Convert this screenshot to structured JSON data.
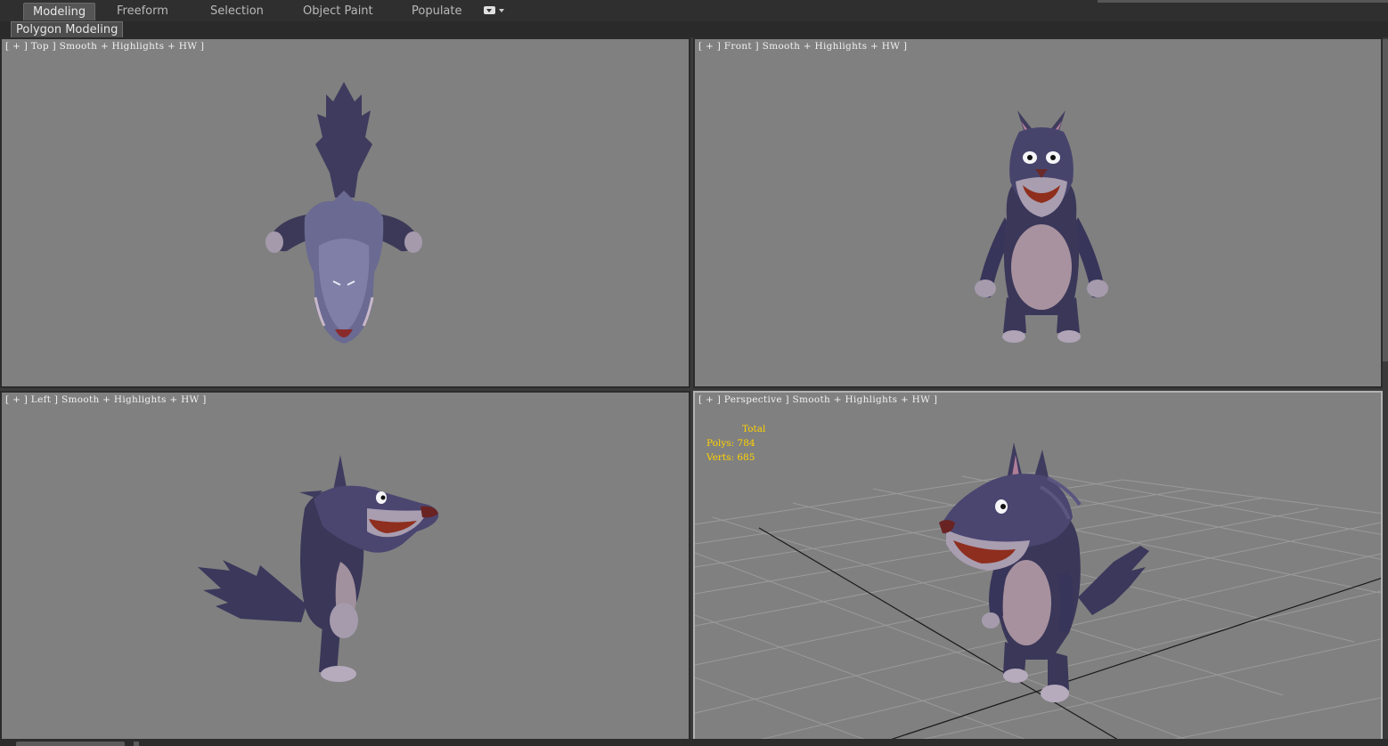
{
  "ribbon": {
    "tabs": [
      "Modeling",
      "Freeform",
      "Selection",
      "Object Paint",
      "Populate"
    ],
    "dropdown_icon": "ribbon-options-icon"
  },
  "subbar": {
    "panel_label": "Polygon Modeling"
  },
  "viewports": {
    "top": {
      "label": "[ + ] Top ] Smooth + Highlights + HW ]"
    },
    "front": {
      "label": "[ + ] Front ] Smooth + Highlights + HW ]"
    },
    "left": {
      "label": "[ + ] Left ] Smooth + Highlights + HW ]"
    },
    "perspective": {
      "label": "[ + ] Perspective ] Smooth + Highlights + HW ]"
    }
  },
  "stats": {
    "header": "Total",
    "polys": "Polys: 784",
    "verts": "Verts: 685"
  },
  "colors": {
    "viewport_bg": "#808080",
    "fur_dark": "#3c3a5a",
    "fur_light": "#a89aae",
    "stats_text": "#ffd200",
    "active_border": "#b3b3b3"
  }
}
